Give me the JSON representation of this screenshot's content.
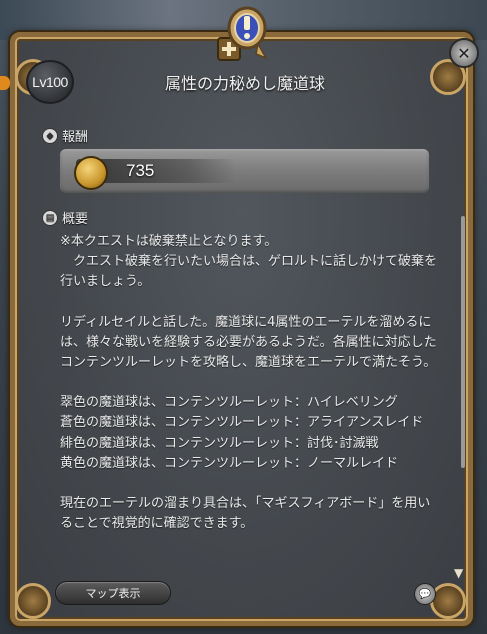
{
  "quest": {
    "level_badge": "Lv100",
    "title": "属性の力秘めし魔道球"
  },
  "reward": {
    "header": "報酬",
    "gil_amount": "735",
    "icon": "gil-coin-icon"
  },
  "summary": {
    "header": "概要",
    "paragraphs": [
      "※本クエストは破棄禁止となります。\n　クエスト破棄を行いたい場合は、ゲロルトに話しかけて破棄を行いましょう。",
      "リディルセイルと話した。魔道球に4属性のエーテルを溜めるには、様々な戦いを経験する必要があるようだ。各属性に対応したコンテンツルーレットを攻略し、魔道球をエーテルで満たそう。",
      "翠色の魔道球は、コンテンツルーレット：ハイレベリング\n蒼色の魔道球は、コンテンツルーレット：アライアンスレイド\n緋色の魔道球は、コンテンツルーレット：討伐･討滅戦\n黄色の魔道球は、コンテンツルーレット：ノーマルレイド",
      "現在のエーテルの溜まり具合は、「マギスフィアボード」を用いることで視覚的に確認できます。"
    ]
  },
  "footer": {
    "map_button": "マップ表示"
  },
  "colors": {
    "frame_gold": "#c9a567",
    "panel_bg": "#43474c",
    "text": "#eaeaea",
    "level_marker": "#e08a1e"
  }
}
